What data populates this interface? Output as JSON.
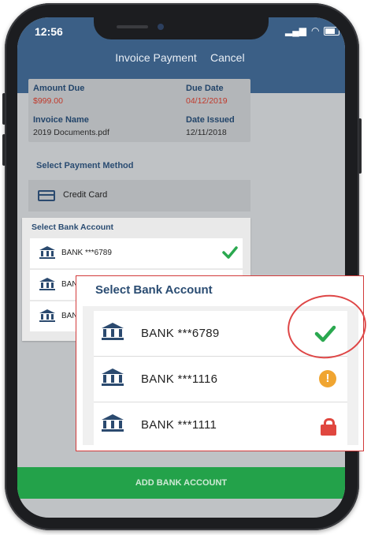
{
  "status": {
    "time": "12:56"
  },
  "header": {
    "title": "Invoice Payment",
    "cancel_label": "Cancel"
  },
  "summary": {
    "amount_due_label": "Amount Due",
    "amount_due_value": "$999.00",
    "due_date_label": "Due Date",
    "due_date_value": "04/12/2019",
    "invoice_name_label": "Invoice Name",
    "invoice_name_value": "2019 Documents.pdf",
    "date_issued_label": "Date Issued",
    "date_issued_value": "12/11/2018"
  },
  "payment": {
    "section_label": "Select Payment Method",
    "credit_card_label": "Credit Card"
  },
  "bank_sheet": {
    "title": "Select Bank Account",
    "accounts": [
      {
        "label": "BANK ***6789",
        "status_icon": "check-icon"
      },
      {
        "label": "BANK ***1116",
        "status_icon": "warning-icon"
      },
      {
        "label": "BANK ***1111",
        "status_icon": "lock-icon"
      }
    ]
  },
  "small_sheet": {
    "title": "Select Bank Account",
    "rows": [
      "BANK ***6789",
      "BAN",
      "BAN"
    ]
  },
  "add_button_label": "ADD BANK ACCOUNT",
  "colors": {
    "header": "#3b5f86",
    "accent_green": "#23a24a",
    "check_green": "#2aa84f",
    "warning_orange": "#f0a531",
    "lock_red": "#e0473f",
    "callout_red": "#d23a3a"
  }
}
